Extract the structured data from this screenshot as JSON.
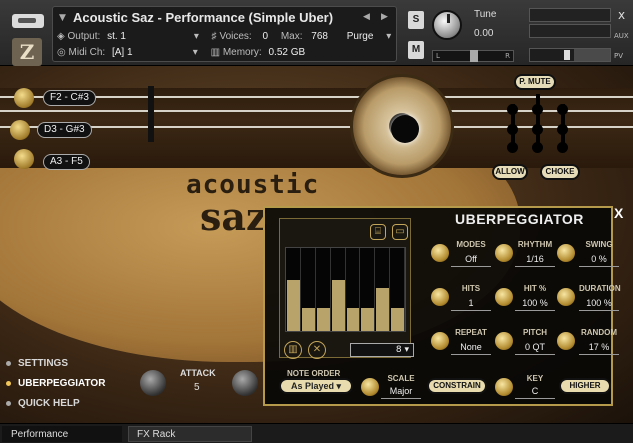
{
  "header": {
    "instrument_name": "Acoustic Saz - Performance (Simple Uber)",
    "output_label": "Output:",
    "output_value": "st. 1",
    "voices_label": "Voices:",
    "voices_value": "0",
    "max_label": "Max:",
    "max_value": "768",
    "purge_label": "Purge",
    "midi_label": "Midi Ch:",
    "midi_value": "[A] 1",
    "memory_label": "Memory:",
    "memory_value": "0.52 GB",
    "s_button": "S",
    "m_button": "M",
    "tune_label": "Tune",
    "tune_value": "0.00",
    "pan_left": "L",
    "pan_right": "R",
    "aux_label": "AUX",
    "pv_label": "PV",
    "close_glyph": "x"
  },
  "instrument": {
    "strings": [
      {
        "label": "F2 - C#3"
      },
      {
        "label": "D3 - G#3"
      },
      {
        "label": "A3 - F5"
      }
    ],
    "logo_line1": "acoustic",
    "logo_line2": "saz",
    "p_mute": "P. MUTE",
    "allow": "ALLOW",
    "choke": "CHOKE"
  },
  "uberpeggiator": {
    "title": "UBERPEGGIATOR",
    "close": "X",
    "steps_value": "8",
    "steps_heights": [
      0.62,
      0.28,
      0.28,
      0.62,
      0.28,
      0.28,
      0.52,
      0.28
    ],
    "params": [
      {
        "label": "MODES",
        "value": "Off"
      },
      {
        "label": "RHYTHM",
        "value": "1/16"
      },
      {
        "label": "SWING",
        "value": "0 %"
      },
      {
        "label": "HITS",
        "value": "1"
      },
      {
        "label": "HIT %",
        "value": "100 %"
      },
      {
        "label": "DURATION",
        "value": "100 %"
      },
      {
        "label": "REPEAT",
        "value": "None"
      },
      {
        "label": "PITCH",
        "value": "0 QT"
      },
      {
        "label": "RANDOM",
        "value": "17 %"
      }
    ],
    "note_order_label": "NOTE ORDER",
    "note_order_value": "As Played",
    "scale_label": "SCALE",
    "scale_value": "Major",
    "constrain_label": "CONSTRAIN",
    "key_label": "KEY",
    "key_value": "C",
    "higher_label": "HIGHER"
  },
  "menu": [
    {
      "label": "SETTINGS",
      "selected": false
    },
    {
      "label": "UBERPEGGIATOR",
      "selected": true
    },
    {
      "label": "QUICK HELP",
      "selected": false
    }
  ],
  "attack": {
    "label": "ATTACK",
    "value": "5"
  },
  "footer": {
    "tab_performance": "Performance",
    "tab_fx_rack": "FX Rack"
  }
}
